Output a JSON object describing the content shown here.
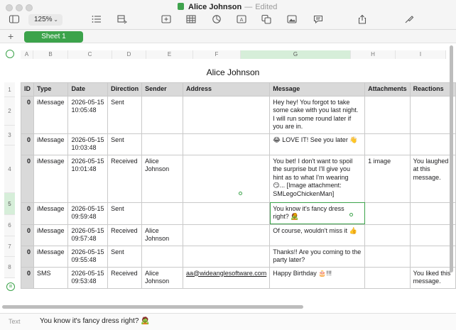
{
  "window": {
    "title": "Alice Johnson",
    "status": "Edited",
    "zoom": "125%"
  },
  "toolbar_icons": [
    "sidebar-icon",
    "list-icon",
    "table-insert-icon",
    "insert-icon",
    "table-icon",
    "chart-icon",
    "text-icon",
    "shape-icon",
    "media-icon",
    "comment-icon",
    "share-icon",
    "format-brush-icon"
  ],
  "sheets": {
    "add_label": "+",
    "tabs": [
      "Sheet 1"
    ]
  },
  "grid": {
    "column_letters": [
      "A",
      "B",
      "C",
      "D",
      "E",
      "F",
      "G",
      "H",
      "I"
    ],
    "selected_column": "G",
    "row_numbers": [
      "1",
      "2",
      "3",
      "4",
      "5",
      "6",
      "7",
      "8"
    ],
    "selected_row": "5"
  },
  "table": {
    "title": "Alice Johnson",
    "headers": [
      "ID",
      "Type",
      "Date",
      "Direction",
      "Sender",
      "Address",
      "Message",
      "Attachments",
      "Reactions"
    ],
    "rows": [
      {
        "id": "0",
        "type": "iMessage",
        "date": "2026-05-15 10:05:48",
        "direction": "Sent",
        "sender": "",
        "address": "",
        "message": "Hey hey! You forgot to take some cake with you last night. I will run some round later if you are in.",
        "attachments": "",
        "reactions": ""
      },
      {
        "id": "0",
        "type": "iMessage",
        "date": "2026-05-15 10:03:48",
        "direction": "Sent",
        "sender": "",
        "address": "",
        "message": "😂 LOVE IT! See you later 👋",
        "attachments": "",
        "reactions": ""
      },
      {
        "id": "0",
        "type": "iMessage",
        "date": "2026-05-15 10:01:48",
        "direction": "Received",
        "sender": "Alice Johnson",
        "address": "",
        "message": "You bet! I don't want to spoil the surprise but I'll give you hint as to what I'm wearing 😏... [Image attachment: SMLegoChickenMan]",
        "attachments": "1 image",
        "reactions": "You laughed at this message."
      },
      {
        "id": "0",
        "type": "iMessage",
        "date": "2026-05-15 09:59:48",
        "direction": "Sent",
        "sender": "",
        "address": "",
        "message": "You know it's fancy dress right? 🧟",
        "attachments": "",
        "reactions": ""
      },
      {
        "id": "0",
        "type": "iMessage",
        "date": "2026-05-15 09:57:48",
        "direction": "Received",
        "sender": "Alice Johnson",
        "address": "",
        "message": "Of course, wouldn't miss it 👍",
        "attachments": "",
        "reactions": ""
      },
      {
        "id": "0",
        "type": "iMessage",
        "date": "2026-05-15 09:55:48",
        "direction": "Sent",
        "sender": "",
        "address": "",
        "message": "Thanks!! Are you coming to the party later?",
        "attachments": "",
        "reactions": ""
      },
      {
        "id": "0",
        "type": "SMS",
        "date": "2026-05-15 09:53:48",
        "direction": "Received",
        "sender": "Alice Johnson",
        "address": "aa@wideanglesoftware.com",
        "message": "Happy Birthday 🎂!!!",
        "attachments": "",
        "reactions": "You liked this message."
      }
    ]
  },
  "formula_bar": {
    "kind": "Text",
    "content": "You know it's fancy dress right? 🧟"
  },
  "colors": {
    "accent": "#3ca34b",
    "header_fill": "#d9d9d9"
  }
}
